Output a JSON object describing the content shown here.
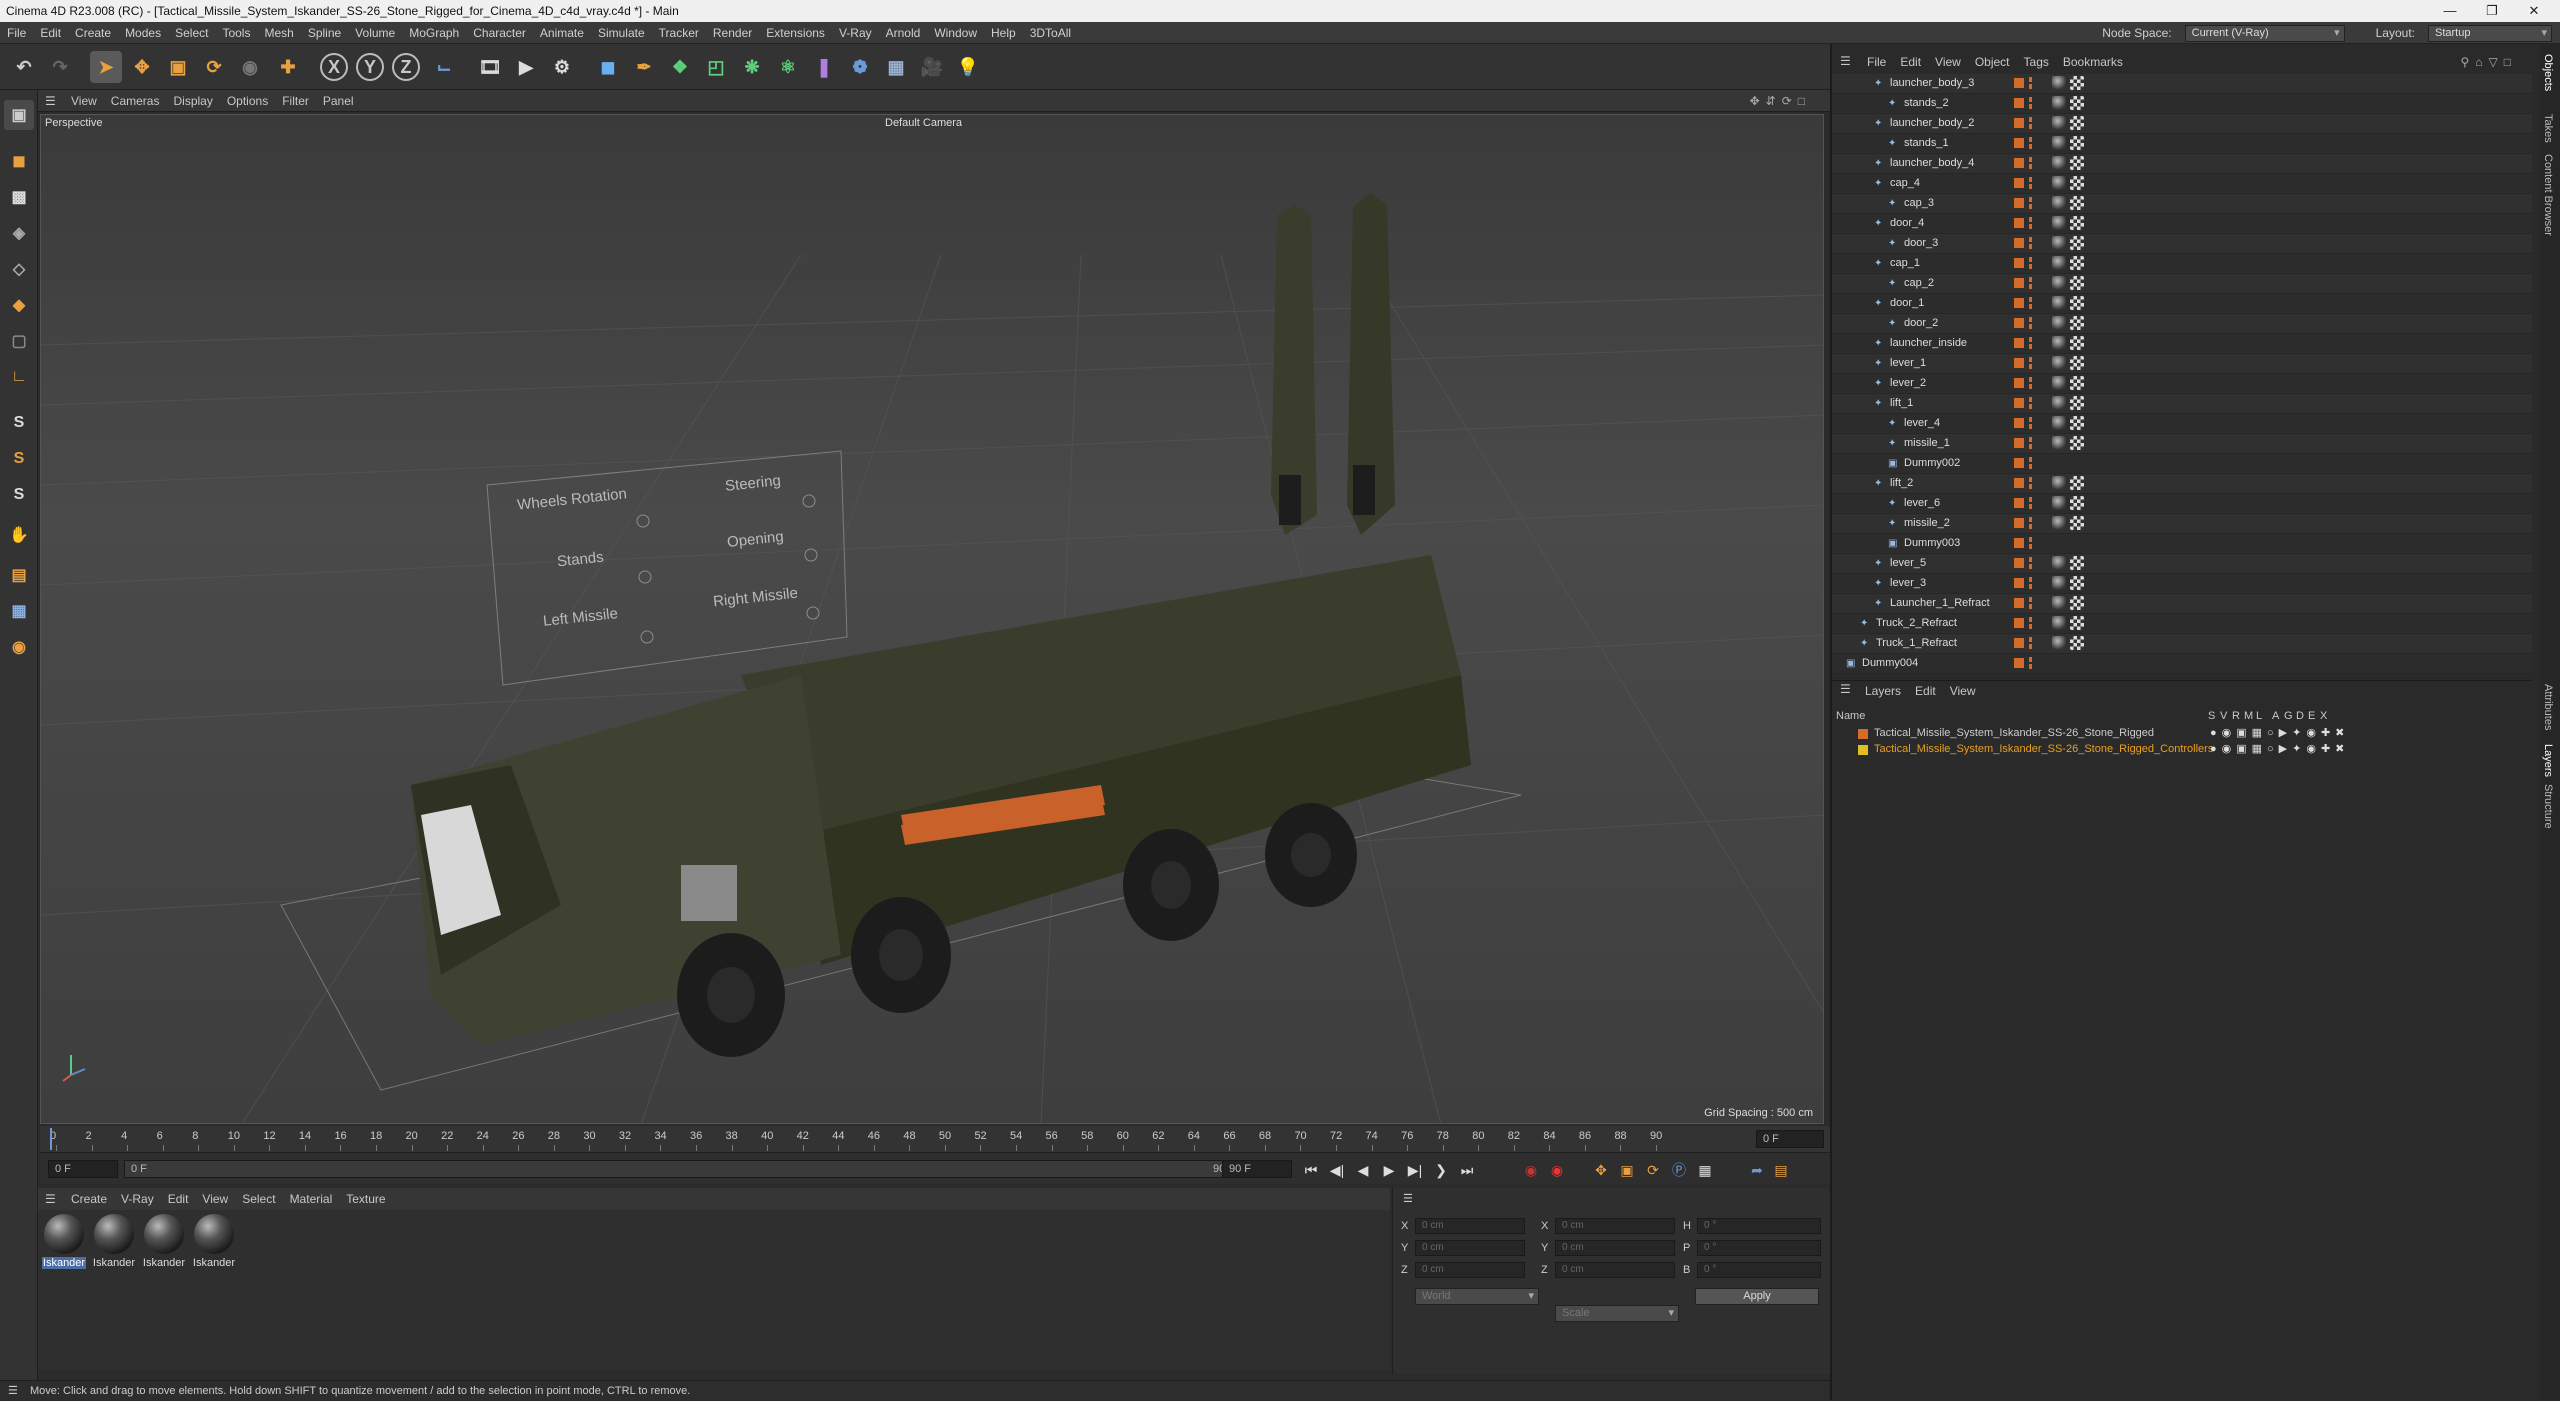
{
  "window": {
    "title": "Cinema 4D R23.008 (RC) - [Tactical_Missile_System_Iskander_SS-26_Stone_Rigged_for_Cinema_4D_c4d_vray.c4d *] - Main"
  },
  "menubar": {
    "items": [
      "File",
      "Edit",
      "Create",
      "Modes",
      "Select",
      "Tools",
      "Mesh",
      "Spline",
      "Volume",
      "MoGraph",
      "Character",
      "Animate",
      "Simulate",
      "Tracker",
      "Render",
      "Extensions",
      "V-Ray",
      "Arnold",
      "Window",
      "Help",
      "3DToAll"
    ],
    "node_space_label": "Node Space:",
    "node_space_value": "Current (V-Ray)",
    "layout_label": "Layout:",
    "layout_value": "Startup"
  },
  "toolbar": {
    "axis_x": "X",
    "axis_y": "Y",
    "axis_z": "Z"
  },
  "viewport": {
    "menu": [
      "View",
      "Cameras",
      "Display",
      "Options",
      "Filter",
      "Panel"
    ],
    "label": "Perspective",
    "camera": "Default Camera",
    "grid_spacing": "Grid Spacing : 500 cm",
    "controller_labels": [
      "Wheels Rotation",
      "Steering",
      "Stands",
      "Opening",
      "Left Missile",
      "Right Missile"
    ]
  },
  "timeline": {
    "ticks": [
      "0",
      "2",
      "4",
      "6",
      "8",
      "10",
      "12",
      "14",
      "16",
      "18",
      "20",
      "22",
      "24",
      "26",
      "28",
      "30",
      "32",
      "34",
      "36",
      "38",
      "40",
      "42",
      "44",
      "46",
      "48",
      "50",
      "52",
      "54",
      "56",
      "58",
      "60",
      "62",
      "64",
      "66",
      "68",
      "70",
      "72",
      "74",
      "76",
      "78",
      "80",
      "82",
      "84",
      "86",
      "88",
      "90"
    ],
    "current_frame": "0 F"
  },
  "transport": {
    "start": "0 F",
    "current": "0 F",
    "end_a": "90 F",
    "end_b": "90 F"
  },
  "materials": {
    "menu": [
      "Create",
      "V-Ray",
      "Edit",
      "View",
      "Select",
      "Material",
      "Texture"
    ],
    "items": [
      "Iskander",
      "Iskander",
      "Iskander",
      "Iskander"
    ]
  },
  "attributes": {
    "labels_left": [
      "X",
      "Y",
      "Z"
    ],
    "labels_mid": [
      "X",
      "Y",
      "Z"
    ],
    "labels_right": [
      "H",
      "P",
      "B"
    ],
    "values_left": [
      "0 cm",
      "0 cm",
      "0 cm"
    ],
    "values_mid": [
      "0 cm",
      "0 cm",
      "0 cm"
    ],
    "values_right": [
      "0 °",
      "0 °",
      "0 °"
    ],
    "coord_mode": "World",
    "scale_mode": "Scale",
    "apply": "Apply"
  },
  "status": {
    "text": "Move: Click and drag to move elements. Hold down SHIFT to quantize movement / add to the selection in point mode, CTRL to remove."
  },
  "objects": {
    "menu": [
      "File",
      "Edit",
      "View",
      "Object",
      "Tags",
      "Bookmarks"
    ],
    "rows": [
      {
        "name": "launcher_body_3",
        "depth": 2
      },
      {
        "name": "stands_2",
        "depth": 3
      },
      {
        "name": "launcher_body_2",
        "depth": 2
      },
      {
        "name": "stands_1",
        "depth": 3
      },
      {
        "name": "launcher_body_4",
        "depth": 2
      },
      {
        "name": "cap_4",
        "depth": 2
      },
      {
        "name": "cap_3",
        "depth": 3
      },
      {
        "name": "door_4",
        "depth": 2
      },
      {
        "name": "door_3",
        "depth": 3
      },
      {
        "name": "cap_1",
        "depth": 2
      },
      {
        "name": "cap_2",
        "depth": 3
      },
      {
        "name": "door_1",
        "depth": 2
      },
      {
        "name": "door_2",
        "depth": 3
      },
      {
        "name": "launcher_inside",
        "depth": 2
      },
      {
        "name": "lever_1",
        "depth": 2
      },
      {
        "name": "lever_2",
        "depth": 2
      },
      {
        "name": "lift_1",
        "depth": 2
      },
      {
        "name": "lever_4",
        "depth": 3
      },
      {
        "name": "missile_1",
        "depth": 3
      },
      {
        "name": "Dummy002",
        "depth": 3
      },
      {
        "name": "lift_2",
        "depth": 2
      },
      {
        "name": "lever_6",
        "depth": 3
      },
      {
        "name": "missile_2",
        "depth": 3
      },
      {
        "name": "Dummy003",
        "depth": 3
      },
      {
        "name": "lever_5",
        "depth": 2
      },
      {
        "name": "lever_3",
        "depth": 2
      },
      {
        "name": "Launcher_1_Refract",
        "depth": 2
      },
      {
        "name": "Truck_2_Refract",
        "depth": 1
      },
      {
        "name": "Truck_1_Refract",
        "depth": 1
      },
      {
        "name": "Dummy004",
        "depth": 0
      }
    ]
  },
  "layers": {
    "menu": [
      "Layers",
      "Edit",
      "View"
    ],
    "header_name": "Name",
    "header_flags": [
      "S",
      "V",
      "R",
      "M",
      "L",
      "A",
      "G",
      "D",
      "E",
      "X"
    ],
    "rows": [
      {
        "name": "Tactical_Missile_System_Iskander_SS-26_Stone_Rigged",
        "color": "#d46b2a",
        "name_color": "#cccccc"
      },
      {
        "name": "Tactical_Missile_System_Iskander_SS-26_Stone_Rigged_Controllers",
        "color": "#e0c020",
        "name_color": "#e8a020"
      }
    ]
  },
  "side_tabs": [
    "Objects",
    "Takes",
    "Content Browser",
    "Attributes",
    "Layers",
    "Structure"
  ],
  "colors": {
    "accent": "#4a6ea5",
    "orange": "#d46b2a",
    "truck": "#3a3d2c"
  }
}
